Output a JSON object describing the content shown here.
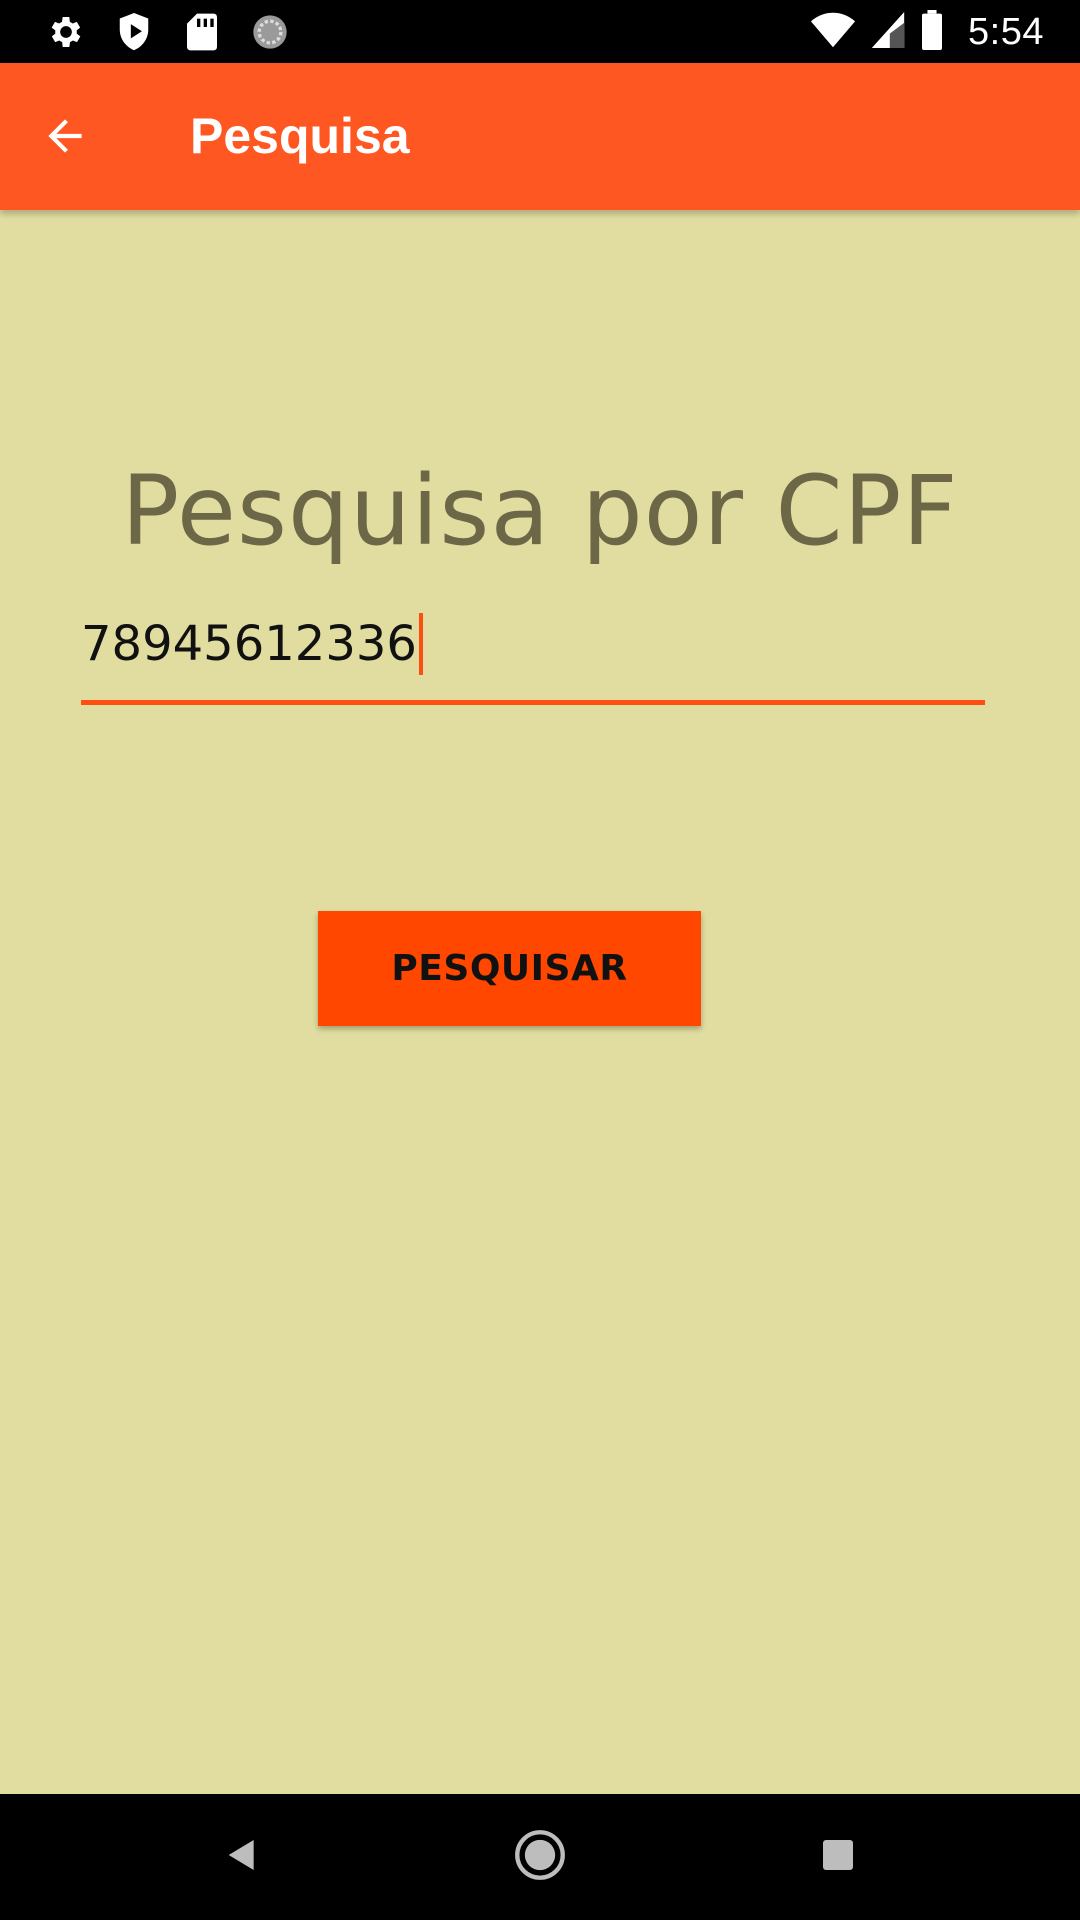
{
  "status_bar": {
    "time": "5:54",
    "left_icons": [
      "settings-icon",
      "shield-play-icon",
      "sd-card-icon",
      "sync-spinner-icon"
    ],
    "right_icons": [
      "wifi-icon",
      "cell-signal-icon",
      "battery-icon"
    ]
  },
  "app_bar": {
    "back_icon": "arrow-back-icon",
    "title": "Pesquisa"
  },
  "main": {
    "heading": "Pesquisa por CPF",
    "cpf_input": {
      "value": "78945612336",
      "placeholder": ""
    },
    "search_button_label": "PESQUISAR"
  },
  "nav_bar": {
    "buttons": [
      "back-triangle-icon",
      "home-circle-icon",
      "recents-square-icon"
    ]
  },
  "colors": {
    "app_bar": "#ff5722",
    "background": "#e1dca0",
    "accent": "#ff4e12",
    "button": "#ff4700",
    "heading_text": "#6b6747"
  }
}
